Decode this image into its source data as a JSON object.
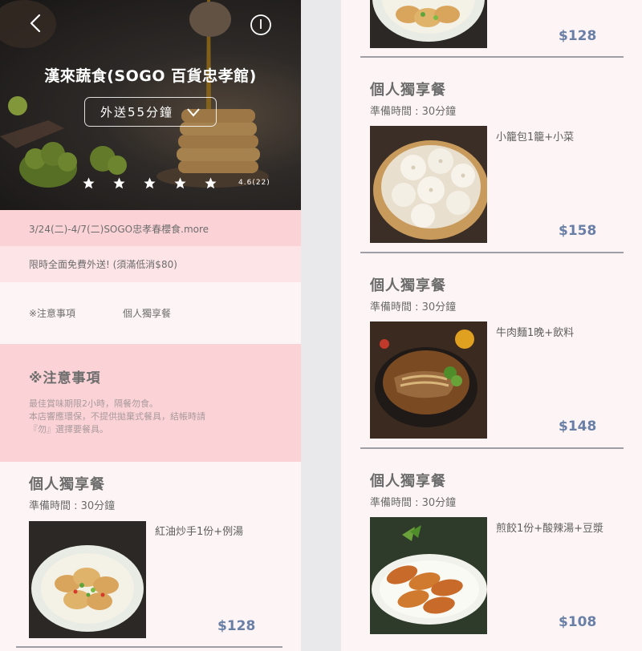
{
  "store": {
    "name": "漢來蔬食(SOGO 百貨忠孝館)",
    "delivery_time": "外送55分鐘",
    "rating": "4.6(22)",
    "stars": 5
  },
  "promos": [
    "3/24(二)-4/7(二)SOGO忠孝春櫻食.more",
    "限時全面免費外送! (須滿低消$80)"
  ],
  "tabs": [
    "※注意事項",
    "個人獨享餐"
  ],
  "notice": {
    "title": "※注意事項",
    "lines": [
      "最佳賞味期限2小時，隔餐勿食。",
      "本店響應環保，不提供拋棄式餐具，結帳時請",
      "『勿』選擇要餐具。"
    ]
  },
  "menu_left": [
    {
      "title": "個人獨享餐",
      "prep": "準備時間 : 30分鐘",
      "desc": "紅油炒手1份+例湯",
      "price": "$128",
      "icon": "wonton-dish-photo"
    }
  ],
  "menu_right": {
    "partial_price": "$128",
    "items": [
      {
        "title": "個人獨享餐",
        "prep": "準備時間 : 30分鐘",
        "desc": "小籠包1籠+小菜",
        "price": "$158",
        "icon": "xiaolongbao-photo"
      },
      {
        "title": "個人獨享餐",
        "prep": "準備時間 : 30分鐘",
        "desc": "牛肉麵1晚+飲料",
        "price": "$148",
        "icon": "beef-noodle-photo"
      },
      {
        "title": "個人獨享餐",
        "prep": "準備時間 : 30分鐘",
        "desc": "煎餃1份+酸辣湯+豆漿",
        "price": "$108",
        "icon": "potsticker-photo"
      }
    ]
  },
  "colors": {
    "accent_pink": "#fbd3d7",
    "light_pink": "#fde4e6",
    "background": "#fdf4f5",
    "price_blue": "#6a7fa6",
    "text_gray": "#6b6b6b"
  }
}
